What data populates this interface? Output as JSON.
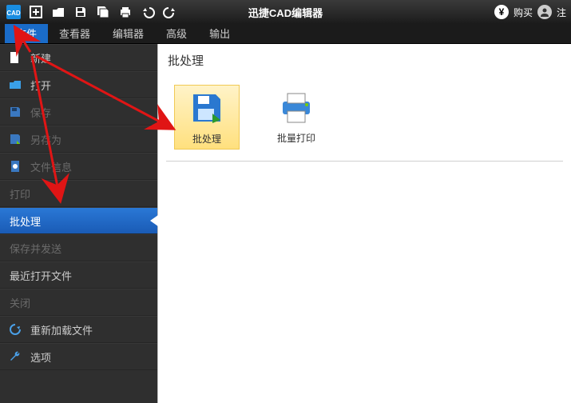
{
  "app": {
    "title": "迅捷CAD编辑器"
  },
  "topright": {
    "buy": "购买",
    "user": "注"
  },
  "tabs": [
    {
      "label": "文件",
      "active": true
    },
    {
      "label": "查看器"
    },
    {
      "label": "编辑器"
    },
    {
      "label": "高级"
    },
    {
      "label": "输出"
    }
  ],
  "sidebar": [
    {
      "key": "new",
      "label": "新建",
      "icon": "file-new",
      "style": "white"
    },
    {
      "key": "open",
      "label": "打开",
      "icon": "folder-open",
      "style": "white"
    },
    {
      "key": "save",
      "label": "保存",
      "icon": "floppy",
      "style": "disabled"
    },
    {
      "key": "saveas",
      "label": "另存为",
      "icon": "floppy-as",
      "style": "disabled"
    },
    {
      "key": "info",
      "label": "文件信息",
      "icon": "file-info",
      "style": "disabled"
    },
    {
      "key": "print",
      "label": "打印",
      "icon": "",
      "style": "disabled"
    },
    {
      "key": "batch",
      "label": "批处理",
      "icon": "",
      "style": "selected"
    },
    {
      "key": "send",
      "label": "保存并发送",
      "icon": "",
      "style": "disabled"
    },
    {
      "key": "recent",
      "label": "最近打开文件",
      "icon": "",
      "style": "white"
    },
    {
      "key": "close",
      "label": "关闭",
      "icon": "",
      "style": "disabled"
    },
    {
      "key": "reload",
      "label": "重新加载文件",
      "icon": "reload",
      "style": "white"
    },
    {
      "key": "opts",
      "label": "选项",
      "icon": "wrench",
      "style": "white"
    }
  ],
  "content": {
    "heading": "批处理",
    "tiles": [
      {
        "key": "batch",
        "label": "批处理",
        "selected": true
      },
      {
        "key": "bprint",
        "label": "批量打印",
        "selected": false
      }
    ]
  },
  "icons": {
    "cad": "CAD",
    "new": "+",
    "open": "folder",
    "save": "floppy",
    "saveas": "floppy-all",
    "print": "printer",
    "undo": "undo",
    "redo": "redo",
    "yen": "¥",
    "user": "user"
  }
}
